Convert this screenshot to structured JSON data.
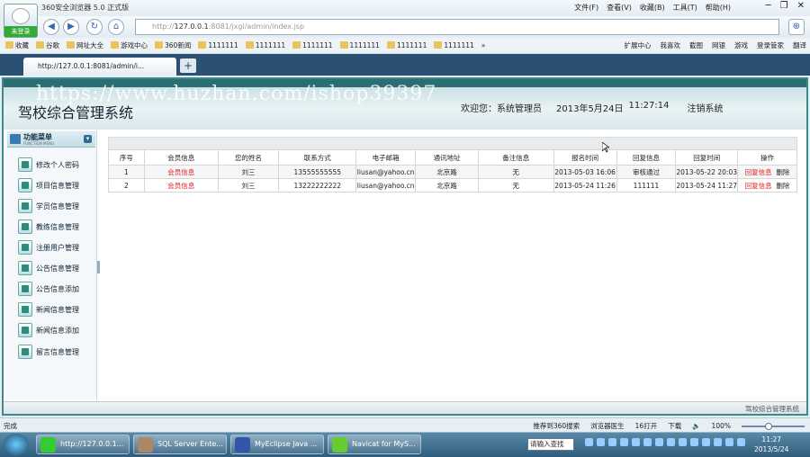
{
  "browser": {
    "window_title": "360安全浏览器 5.0 正式版",
    "login_label": "未登录",
    "menus": [
      "文件(F)",
      "查看(V)",
      "收藏(B)",
      "工具(T)",
      "帮助(H)"
    ],
    "address_prefix": "http://",
    "address_host": "127.0.0.1",
    "address_rest": ":8081/jxgl/admin/index.jsp",
    "favorites": [
      "收藏",
      "谷歌",
      "网址大全",
      "游戏中心",
      "360新闻",
      "1111111",
      "1111111",
      "1111111",
      "1111111",
      "1111111",
      "1111111"
    ],
    "fav_more": "»",
    "fav_right": [
      "扩展中心",
      "我喜欢",
      "截图",
      "网银",
      "游戏",
      "登录管家",
      "翻译"
    ],
    "tab_title": "http://127.0.0.1:8081/admin/i...",
    "new_tab": "+"
  },
  "page": {
    "watermark": "https://www.huzhan.com/ishop39397",
    "system_title": "驾校综合管理系统",
    "welcome": "欢迎您：",
    "user": "系统管理员",
    "date": "2013年5月24日",
    "time": "11:27:14",
    "logout": "注销系统",
    "footer": "驾校综合管理系统"
  },
  "sidebar": {
    "title": "功能菜单",
    "subtitle": "FUNCTION MENU",
    "items": [
      "修改个人密码",
      "项目信息管理",
      "学员信息管理",
      "教练信息管理",
      "注册用户管理",
      "公告信息管理",
      "公告信息添加",
      "新闻信息管理",
      "新闻信息添加",
      "留言信息管理"
    ]
  },
  "table": {
    "headers": [
      "序号",
      "会员信息",
      "您的姓名",
      "联系方式",
      "电子邮箱",
      "通讯地址",
      "备注信息",
      "报名时间",
      "回复信息",
      "回复时间",
      "操作"
    ],
    "rows": [
      {
        "no": "1",
        "member": "会员信息",
        "name": "刘三",
        "phone": "13555555555",
        "email": "liusan@yahoo.cn",
        "address": "北京路",
        "note": "无",
        "signup": "2013-05-03 16:06",
        "reply": "审核通过",
        "reply_time": "2013-05-22 20:03",
        "op_reply": "回复信息",
        "op_delete": "删除"
      },
      {
        "no": "2",
        "member": "会员信息",
        "name": "刘三",
        "phone": "13222222222",
        "email": "liusan@yahoo.cn",
        "address": "北京路",
        "note": "无",
        "signup": "2013-05-24 11:26",
        "reply": "111111",
        "reply_time": "2013-05-24 11:27",
        "op_reply": "回复信息",
        "op_delete": "删除"
      }
    ]
  },
  "statusbar": {
    "left": "完成",
    "items": [
      "推荐到360搜索",
      "浏览器医生",
      "16打开",
      "下载"
    ],
    "zoom": "100%"
  },
  "taskbar": {
    "tasks": [
      "http://127.0.0.1...",
      "SQL Server Ente...",
      "MyEclipse Java ...",
      "Navicat for MyS..."
    ],
    "ime": "请输入查找",
    "time": "11:27",
    "date": "2013/5/24"
  }
}
